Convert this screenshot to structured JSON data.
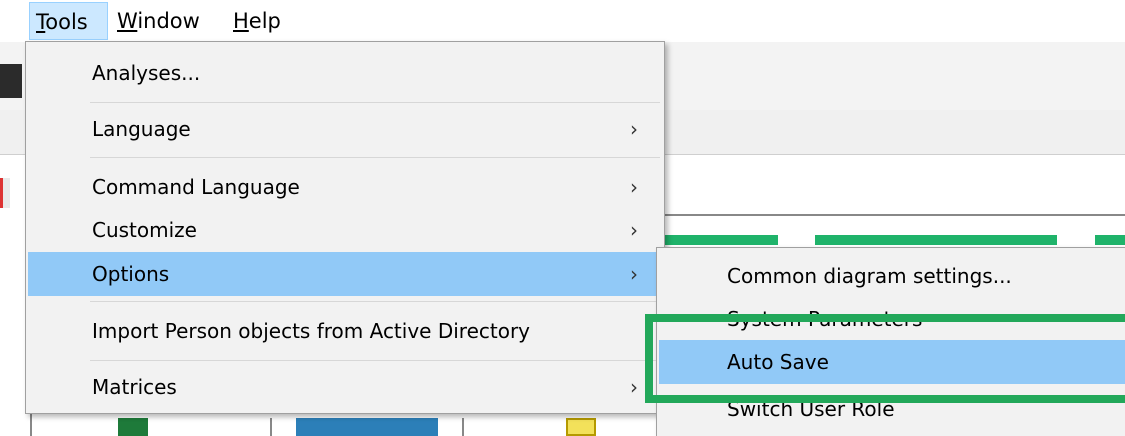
{
  "menubar": {
    "items": [
      {
        "accel": "T",
        "rest": "ools"
      },
      {
        "accel": "W",
        "rest": "indow"
      },
      {
        "accel": "H",
        "rest": "elp"
      }
    ]
  },
  "tools_menu": {
    "items": {
      "analyses": "Analyses...",
      "language": "Language",
      "command_language": "Command Language",
      "customize": "Customize",
      "options": "Options",
      "import_person": "Import Person objects from Active Directory",
      "matrices": "Matrices"
    }
  },
  "options_submenu": {
    "items": {
      "common_diagram_settings": "Common diagram settings...",
      "system_parameters": "System Parameters",
      "auto_save": "Auto Save",
      "switch_user_role": "Switch User Role"
    }
  },
  "glyphs": {
    "submenu_arrow": "›"
  },
  "colors": {
    "highlight": "#91c9f7",
    "menu_bg": "#f2f2f2",
    "annotation_outline": "#22a85a"
  }
}
